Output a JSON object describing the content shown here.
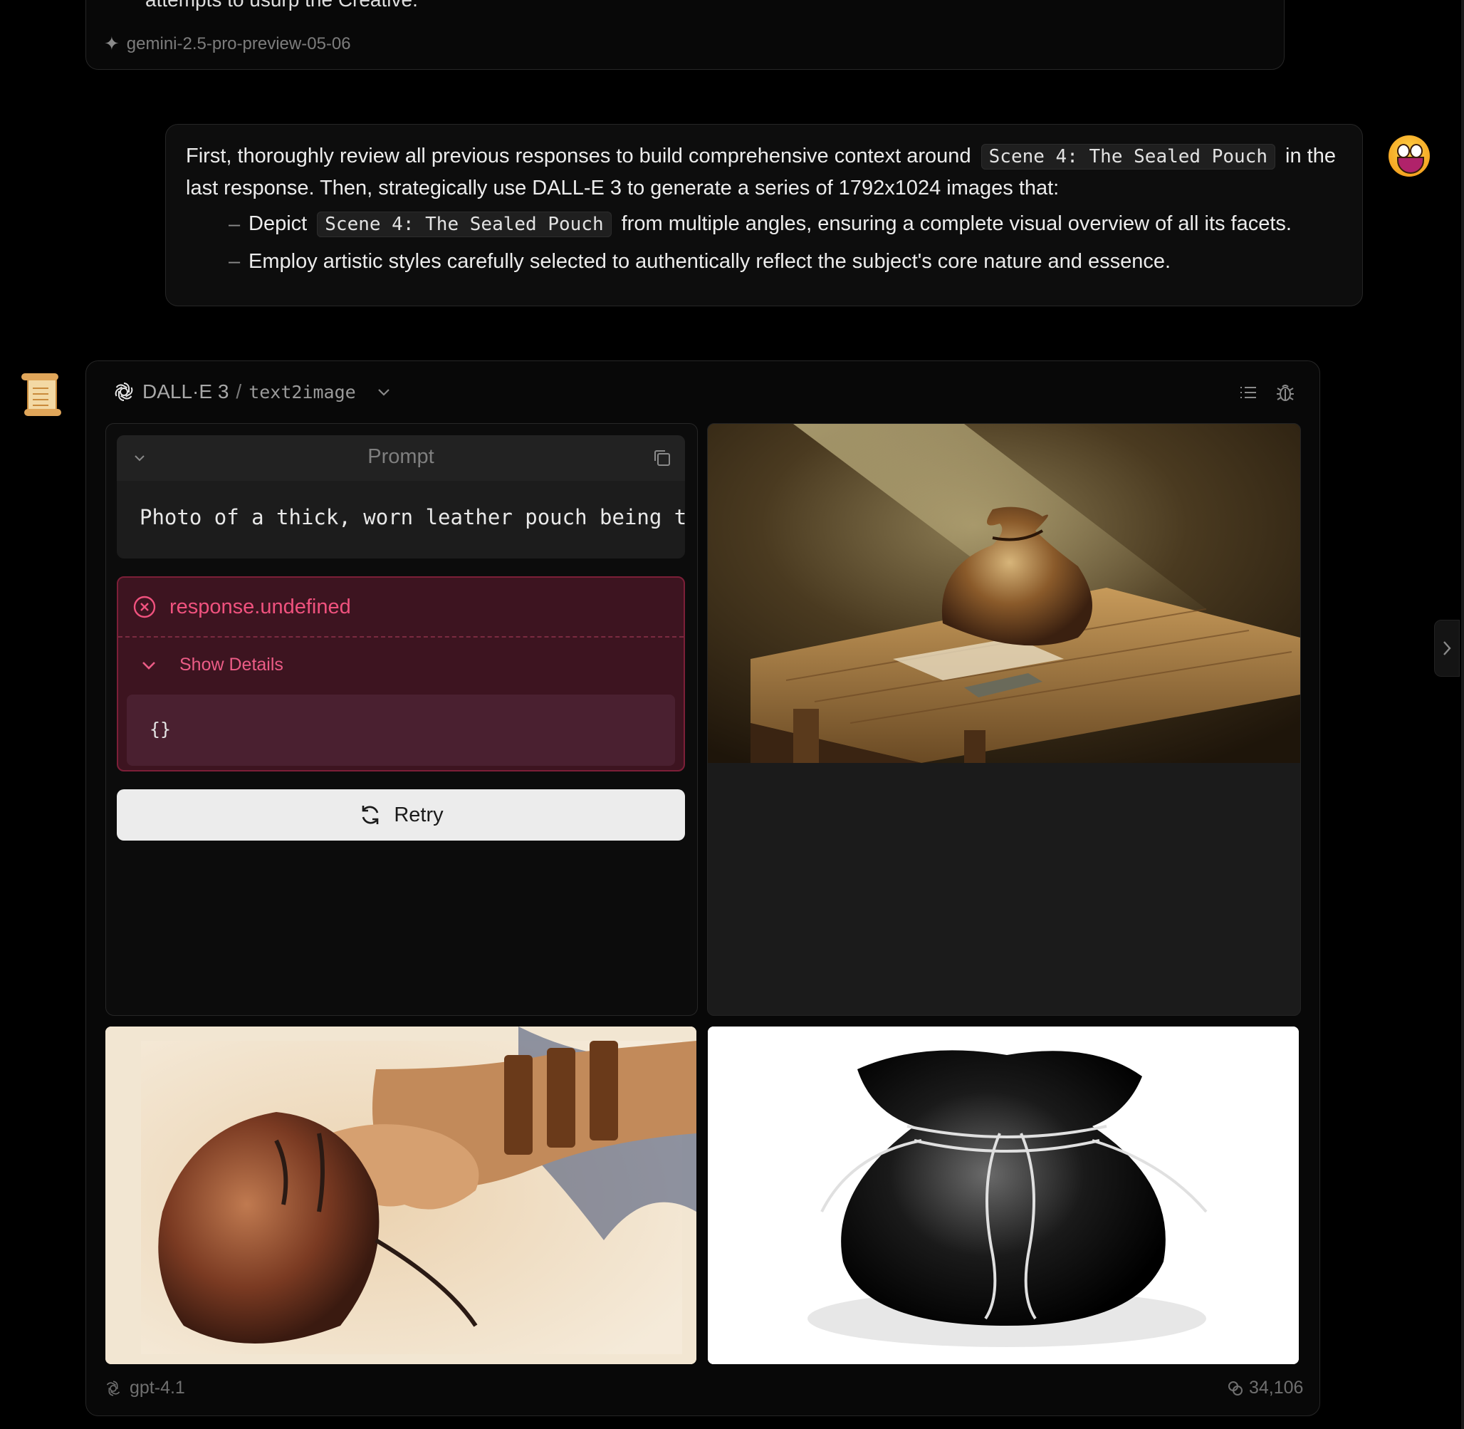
{
  "previous_message": {
    "tail_text": "attempts to usurp the Creative.",
    "model": "gemini-2.5-pro-preview-05-06"
  },
  "user_message": {
    "line1_before": "First, thoroughly review all previous responses to build comprehensive context around",
    "code_scene": "Scene 4: The Sealed Pouch",
    "line1_after": "in the last response. Then, strategically use DALL-E 3 to generate a series of 1792x1024 images that:",
    "bullets": [
      {
        "before": "Depict",
        "code": "Scene 4: The Sealed Pouch",
        "after": "from multiple angles, ensuring a complete visual overview of all its facets."
      },
      {
        "text": "Employ artistic styles carefully selected to authentically reflect the subject's core nature and essence."
      }
    ]
  },
  "tool": {
    "provider": "DALL·E 3",
    "separator": "/",
    "api": "text2image"
  },
  "prompt": {
    "title": "Prompt",
    "text": "Photo of a thick, worn leather pouch being tightly sealed"
  },
  "error": {
    "title": "response.undefined",
    "details_label": "Show Details",
    "code": "{}"
  },
  "retry_label": "Retry",
  "footer": {
    "model": "gpt-4.1",
    "tokens": "34,106"
  },
  "colors": {
    "background": "#000000",
    "error_text": "#f0527e",
    "error_bg": "#3d1420"
  }
}
